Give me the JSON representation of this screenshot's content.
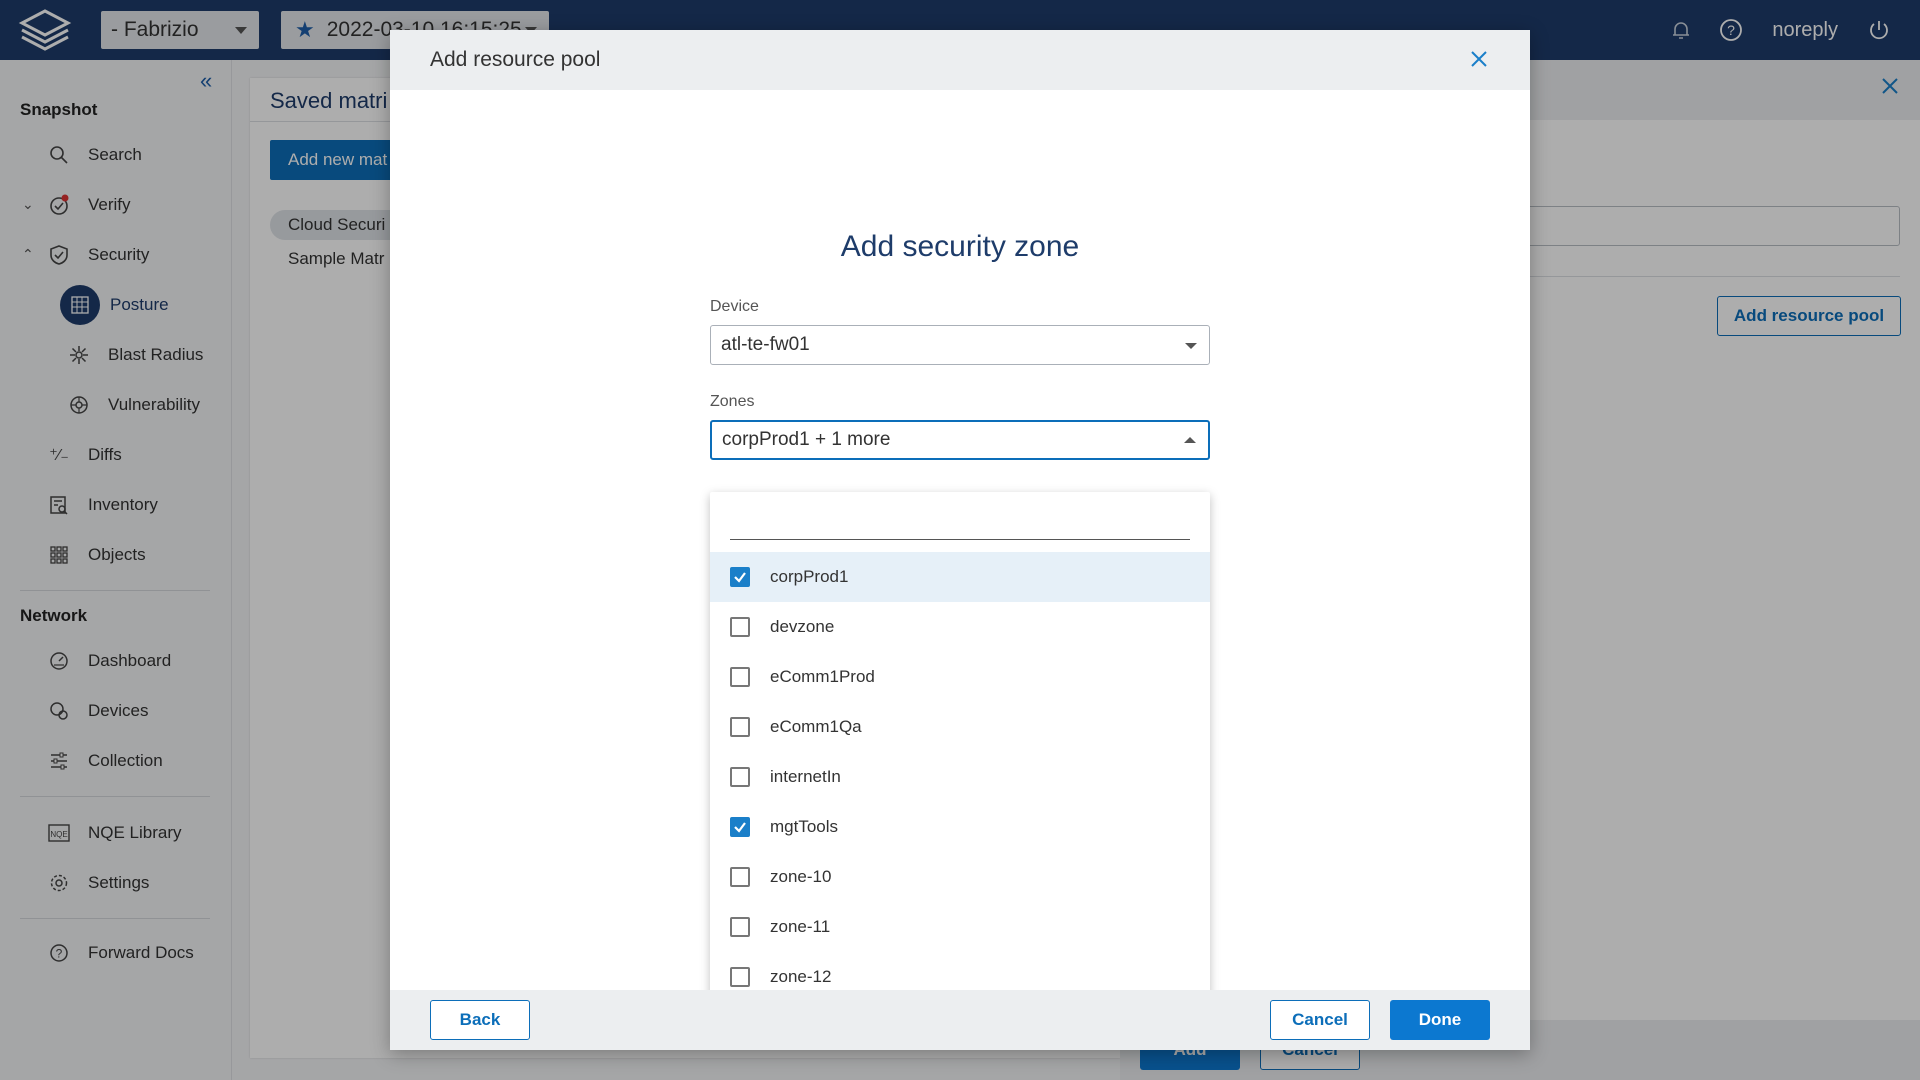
{
  "topbar": {
    "network": "- Fabrizio",
    "snapshot": "2022-03-10 16:15:25",
    "user": "noreply"
  },
  "sidebar": {
    "snapshot_title": "Snapshot",
    "network_title": "Network",
    "items": {
      "search": "Search",
      "verify": "Verify",
      "security": "Security",
      "posture": "Posture",
      "blast_radius": "Blast Radius",
      "vulnerability": "Vulnerability",
      "diffs": "Diffs",
      "inventory": "Inventory",
      "objects": "Objects",
      "dashboard": "Dashboard",
      "devices": "Devices",
      "collection": "Collection",
      "nqe_library": "NQE Library",
      "settings": "Settings",
      "forward_docs": "Forward Docs"
    }
  },
  "background": {
    "main_title": "Saved matri",
    "add_button": "Add new mat",
    "list": [
      "Cloud Securi",
      "Sample Matr"
    ],
    "add_resource_pool_button": "Add resource pool",
    "footer_buttons": [
      "Add",
      "Cancel"
    ]
  },
  "modal": {
    "title": "Add resource pool",
    "subtitle": "Add security zone",
    "device_label": "Device",
    "device_value": "atl-te-fw01",
    "zones_label": "Zones",
    "zones_value": "corpProd1 + 1 more",
    "search_value": "",
    "options": [
      {
        "label": "corpProd1",
        "checked": true
      },
      {
        "label": "devzone",
        "checked": false
      },
      {
        "label": "eComm1Prod",
        "checked": false
      },
      {
        "label": "eComm1Qa",
        "checked": false
      },
      {
        "label": "internetIn",
        "checked": false
      },
      {
        "label": "mgtTools",
        "checked": true
      },
      {
        "label": "zone-10",
        "checked": false
      },
      {
        "label": "zone-11",
        "checked": false
      },
      {
        "label": "zone-12",
        "checked": false
      }
    ],
    "back_label": "Back",
    "cancel_label": "Cancel",
    "done_label": "Done"
  },
  "colors": {
    "topbar": "#1e3c6a",
    "primary": "#0c78d0",
    "checked": "#1a7fc9"
  }
}
